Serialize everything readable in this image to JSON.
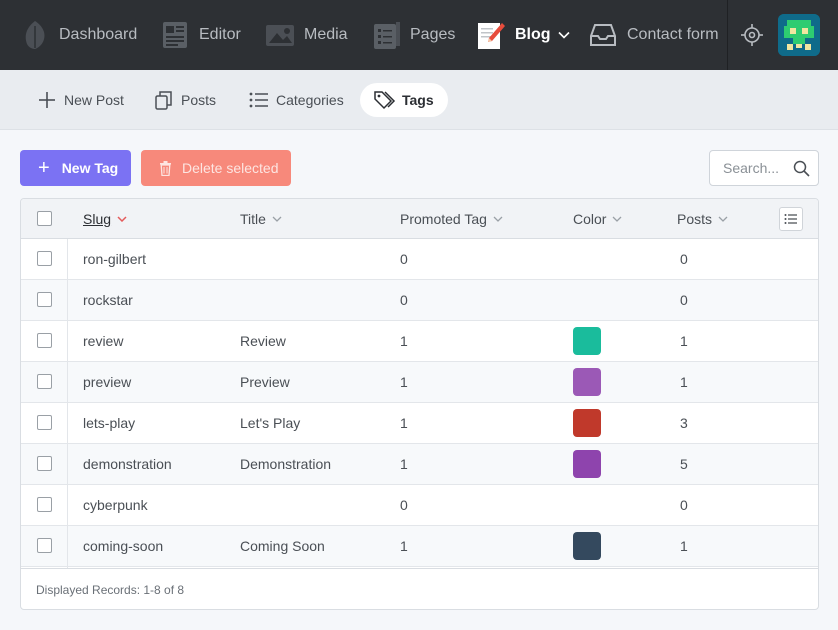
{
  "topnav": {
    "items": [
      {
        "label": "Dashboard",
        "icon": "leaf-icon"
      },
      {
        "label": "Editor",
        "icon": "newspaper-icon"
      },
      {
        "label": "Media",
        "icon": "image-icon"
      },
      {
        "label": "Pages",
        "icon": "clipboard-list-icon"
      },
      {
        "label": "Blog",
        "icon": "blog-pencil-icon",
        "active": true
      },
      {
        "label": "Contact form",
        "icon": "inbox-icon"
      }
    ],
    "settings_icon": "crosshair-icon",
    "avatar_icon": "pixel-avatar"
  },
  "subnav": {
    "items": [
      {
        "label": "New Post",
        "icon": "plus-icon"
      },
      {
        "label": "Posts",
        "icon": "copy-icon"
      },
      {
        "label": "Categories",
        "icon": "list-icon"
      },
      {
        "label": "Tags",
        "icon": "tags-icon",
        "active": true
      }
    ]
  },
  "toolbar": {
    "new_label": "New Tag",
    "delete_label": "Delete selected",
    "search_placeholder": "Search..."
  },
  "table": {
    "headers": {
      "slug": "Slug",
      "title": "Title",
      "promoted": "Promoted Tag",
      "color": "Color",
      "posts": "Posts"
    },
    "sorted_by": "slug",
    "rows": [
      {
        "slug": "ron-gilbert",
        "title": "",
        "promoted": "0",
        "color": "",
        "posts": "0"
      },
      {
        "slug": "rockstar",
        "title": "",
        "promoted": "0",
        "color": "",
        "posts": "0"
      },
      {
        "slug": "review",
        "title": "Review",
        "promoted": "1",
        "color": "#1abc9c",
        "posts": "1"
      },
      {
        "slug": "preview",
        "title": "Preview",
        "promoted": "1",
        "color": "#9b59b6",
        "posts": "1"
      },
      {
        "slug": "lets-play",
        "title": "Let's Play",
        "promoted": "1",
        "color": "#c0392b",
        "posts": "3"
      },
      {
        "slug": "demonstration",
        "title": "Demonstration",
        "promoted": "1",
        "color": "#8e44ad",
        "posts": "5"
      },
      {
        "slug": "cyberpunk",
        "title": "",
        "promoted": "0",
        "color": "",
        "posts": "0"
      },
      {
        "slug": "coming-soon",
        "title": "Coming Soon",
        "promoted": "1",
        "color": "#34495e",
        "posts": "1"
      }
    ],
    "footer": "Displayed Records: 1-8 of 8"
  },
  "colors": {
    "nav_bg": "#2d3034",
    "primary": "#7b72f3",
    "danger": "#f7897b"
  }
}
